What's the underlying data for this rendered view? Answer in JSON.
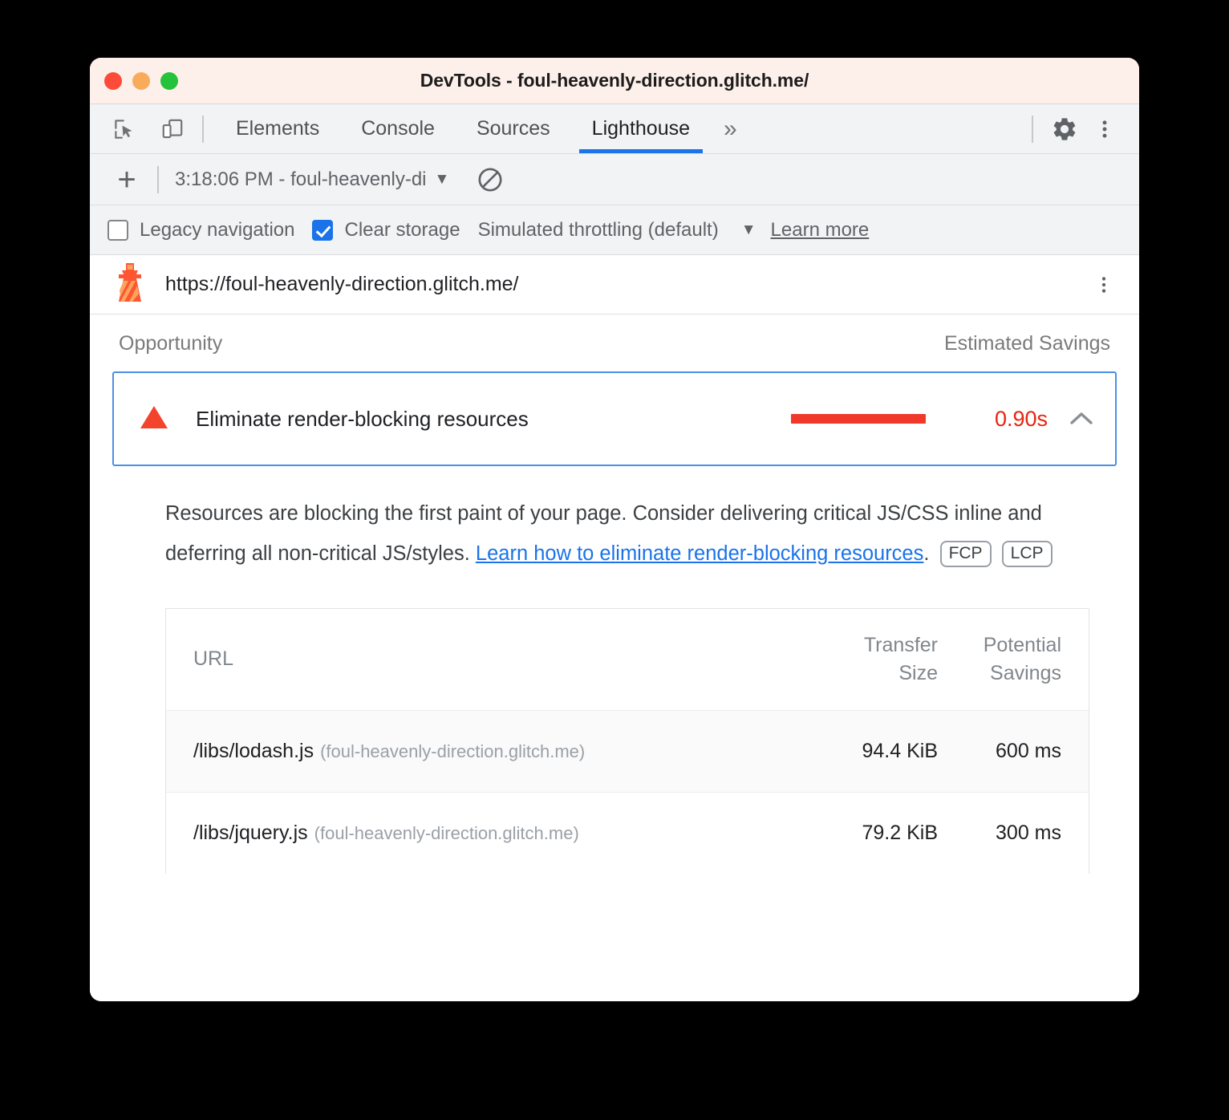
{
  "window": {
    "title": "DevTools - foul-heavenly-direction.glitch.me/",
    "traffic_lights": [
      "close",
      "minimize",
      "zoom"
    ]
  },
  "tabbar": {
    "inspect_icon": "inspect-element-icon",
    "device_icon": "device-toolbar-icon",
    "tabs": [
      {
        "label": "Elements",
        "active": false
      },
      {
        "label": "Console",
        "active": false
      },
      {
        "label": "Sources",
        "active": false
      },
      {
        "label": "Lighthouse",
        "active": true
      }
    ],
    "more_tabs": "»",
    "settings_icon": "gear-icon",
    "menu_icon": "kebab-menu-icon"
  },
  "runbar": {
    "add_label": "+",
    "run_selected": "3:18:06 PM - foul-heavenly-di",
    "caret": "▼",
    "clear_icon": "no-entry-icon"
  },
  "options": {
    "legacy_navigation": {
      "label": "Legacy navigation",
      "checked": false
    },
    "clear_storage": {
      "label": "Clear storage",
      "checked": true
    },
    "throttling": {
      "label": "Simulated throttling (default)",
      "caret": "▼"
    },
    "learn_more": "Learn more"
  },
  "report": {
    "lighthouse_icon": "lighthouse-icon",
    "url": "https://foul-heavenly-direction.glitch.me/",
    "menu_icon": "kebab-menu-icon",
    "columns": {
      "opportunity": "Opportunity",
      "estimated_savings": "Estimated Savings"
    },
    "opportunity": {
      "severity_icon": "warning-triangle-icon",
      "title": "Eliminate render-blocking resources",
      "savings": "0.90s",
      "savings_bar_color": "#f0392b",
      "savings_text_color": "#e8230f",
      "expanded": true,
      "toggle_icon": "chevron-up-icon",
      "description_part1": "Resources are blocking the first paint of your page. Consider delivering critical JS/CSS inline and deferring all non-critical JS/styles. ",
      "description_link": "Learn how to eliminate render-blocking resources",
      "description_part2": ".",
      "metric_badges": [
        "FCP",
        "LCP"
      ]
    },
    "table": {
      "headers": {
        "url": "URL",
        "transfer_size_line1": "Transfer",
        "transfer_size_line2": "Size",
        "potential_savings_line1": "Potential",
        "potential_savings_line2": "Savings"
      },
      "rows": [
        {
          "url": "/libs/lodash.js",
          "host": "(foul-heavenly-direction.glitch.me)",
          "transfer_size": "94.4 KiB",
          "potential_savings": "600 ms"
        },
        {
          "url": "/libs/jquery.js",
          "host": "(foul-heavenly-direction.glitch.me)",
          "transfer_size": "79.2 KiB",
          "potential_savings": "300 ms"
        }
      ]
    }
  },
  "colors": {
    "accent_blue": "#1a73e8",
    "title_bg": "#fdf0ea",
    "toolbar_bg": "#f1f3f4",
    "selection_border": "#4a90e2"
  }
}
